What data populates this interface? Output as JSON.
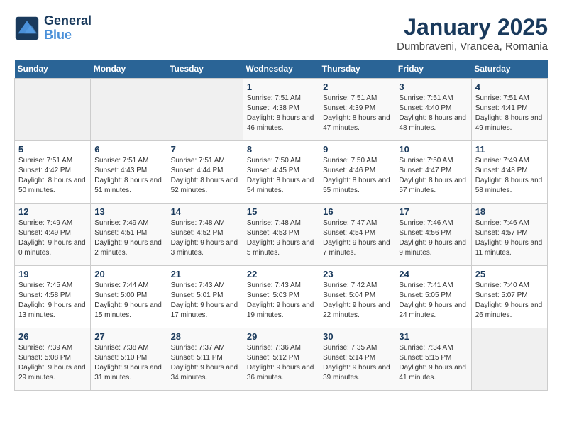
{
  "header": {
    "logo_line1": "General",
    "logo_line2": "Blue",
    "title": "January 2025",
    "subtitle": "Dumbraveni, Vrancea, Romania"
  },
  "weekdays": [
    "Sunday",
    "Monday",
    "Tuesday",
    "Wednesday",
    "Thursday",
    "Friday",
    "Saturday"
  ],
  "weeks": [
    [
      {
        "day": "",
        "info": ""
      },
      {
        "day": "",
        "info": ""
      },
      {
        "day": "",
        "info": ""
      },
      {
        "day": "1",
        "info": "Sunrise: 7:51 AM\nSunset: 4:38 PM\nDaylight: 8 hours\nand 46 minutes."
      },
      {
        "day": "2",
        "info": "Sunrise: 7:51 AM\nSunset: 4:39 PM\nDaylight: 8 hours\nand 47 minutes."
      },
      {
        "day": "3",
        "info": "Sunrise: 7:51 AM\nSunset: 4:40 PM\nDaylight: 8 hours\nand 48 minutes."
      },
      {
        "day": "4",
        "info": "Sunrise: 7:51 AM\nSunset: 4:41 PM\nDaylight: 8 hours\nand 49 minutes."
      }
    ],
    [
      {
        "day": "5",
        "info": "Sunrise: 7:51 AM\nSunset: 4:42 PM\nDaylight: 8 hours\nand 50 minutes."
      },
      {
        "day": "6",
        "info": "Sunrise: 7:51 AM\nSunset: 4:43 PM\nDaylight: 8 hours\nand 51 minutes."
      },
      {
        "day": "7",
        "info": "Sunrise: 7:51 AM\nSunset: 4:44 PM\nDaylight: 8 hours\nand 52 minutes."
      },
      {
        "day": "8",
        "info": "Sunrise: 7:50 AM\nSunset: 4:45 PM\nDaylight: 8 hours\nand 54 minutes."
      },
      {
        "day": "9",
        "info": "Sunrise: 7:50 AM\nSunset: 4:46 PM\nDaylight: 8 hours\nand 55 minutes."
      },
      {
        "day": "10",
        "info": "Sunrise: 7:50 AM\nSunset: 4:47 PM\nDaylight: 8 hours\nand 57 minutes."
      },
      {
        "day": "11",
        "info": "Sunrise: 7:49 AM\nSunset: 4:48 PM\nDaylight: 8 hours\nand 58 minutes."
      }
    ],
    [
      {
        "day": "12",
        "info": "Sunrise: 7:49 AM\nSunset: 4:49 PM\nDaylight: 9 hours\nand 0 minutes."
      },
      {
        "day": "13",
        "info": "Sunrise: 7:49 AM\nSunset: 4:51 PM\nDaylight: 9 hours\nand 2 minutes."
      },
      {
        "day": "14",
        "info": "Sunrise: 7:48 AM\nSunset: 4:52 PM\nDaylight: 9 hours\nand 3 minutes."
      },
      {
        "day": "15",
        "info": "Sunrise: 7:48 AM\nSunset: 4:53 PM\nDaylight: 9 hours\nand 5 minutes."
      },
      {
        "day": "16",
        "info": "Sunrise: 7:47 AM\nSunset: 4:54 PM\nDaylight: 9 hours\nand 7 minutes."
      },
      {
        "day": "17",
        "info": "Sunrise: 7:46 AM\nSunset: 4:56 PM\nDaylight: 9 hours\nand 9 minutes."
      },
      {
        "day": "18",
        "info": "Sunrise: 7:46 AM\nSunset: 4:57 PM\nDaylight: 9 hours\nand 11 minutes."
      }
    ],
    [
      {
        "day": "19",
        "info": "Sunrise: 7:45 AM\nSunset: 4:58 PM\nDaylight: 9 hours\nand 13 minutes."
      },
      {
        "day": "20",
        "info": "Sunrise: 7:44 AM\nSunset: 5:00 PM\nDaylight: 9 hours\nand 15 minutes."
      },
      {
        "day": "21",
        "info": "Sunrise: 7:43 AM\nSunset: 5:01 PM\nDaylight: 9 hours\nand 17 minutes."
      },
      {
        "day": "22",
        "info": "Sunrise: 7:43 AM\nSunset: 5:03 PM\nDaylight: 9 hours\nand 19 minutes."
      },
      {
        "day": "23",
        "info": "Sunrise: 7:42 AM\nSunset: 5:04 PM\nDaylight: 9 hours\nand 22 minutes."
      },
      {
        "day": "24",
        "info": "Sunrise: 7:41 AM\nSunset: 5:05 PM\nDaylight: 9 hours\nand 24 minutes."
      },
      {
        "day": "25",
        "info": "Sunrise: 7:40 AM\nSunset: 5:07 PM\nDaylight: 9 hours\nand 26 minutes."
      }
    ],
    [
      {
        "day": "26",
        "info": "Sunrise: 7:39 AM\nSunset: 5:08 PM\nDaylight: 9 hours\nand 29 minutes."
      },
      {
        "day": "27",
        "info": "Sunrise: 7:38 AM\nSunset: 5:10 PM\nDaylight: 9 hours\nand 31 minutes."
      },
      {
        "day": "28",
        "info": "Sunrise: 7:37 AM\nSunset: 5:11 PM\nDaylight: 9 hours\nand 34 minutes."
      },
      {
        "day": "29",
        "info": "Sunrise: 7:36 AM\nSunset: 5:12 PM\nDaylight: 9 hours\nand 36 minutes."
      },
      {
        "day": "30",
        "info": "Sunrise: 7:35 AM\nSunset: 5:14 PM\nDaylight: 9 hours\nand 39 minutes."
      },
      {
        "day": "31",
        "info": "Sunrise: 7:34 AM\nSunset: 5:15 PM\nDaylight: 9 hours\nand 41 minutes."
      },
      {
        "day": "",
        "info": ""
      }
    ]
  ]
}
